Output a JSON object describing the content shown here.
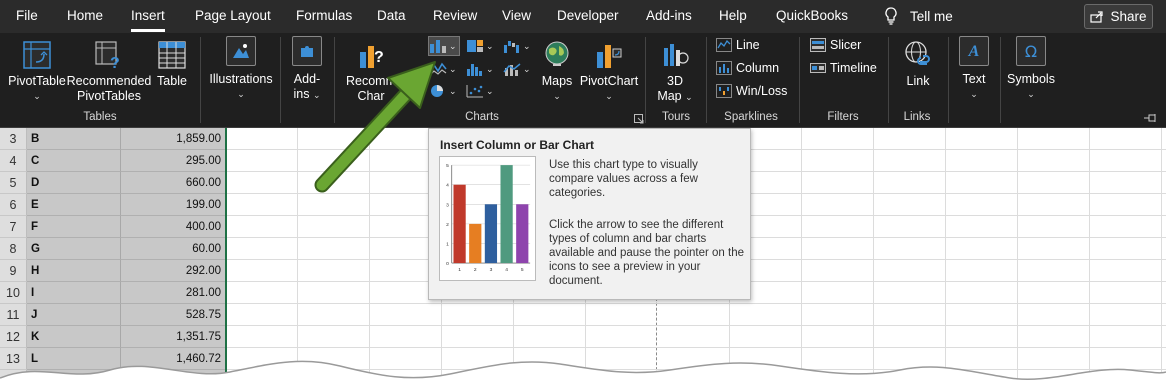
{
  "menu": {
    "tabs": [
      {
        "label": "File"
      },
      {
        "label": "Home"
      },
      {
        "label": "Insert"
      },
      {
        "label": "Page Layout"
      },
      {
        "label": "Formulas"
      },
      {
        "label": "Data"
      },
      {
        "label": "Review"
      },
      {
        "label": "View"
      },
      {
        "label": "Developer"
      },
      {
        "label": "Add-ins"
      },
      {
        "label": "Help"
      },
      {
        "label": "QuickBooks"
      }
    ],
    "active_tab": "Insert",
    "tell_me": "Tell me",
    "share": "Share"
  },
  "ribbon": {
    "groups": {
      "tables": "Tables",
      "charts": "Charts",
      "tours": "Tours",
      "sparklines": "Sparklines",
      "filters": "Filters",
      "links": "Links"
    },
    "pivot_table": "PivotTable",
    "recommended_line1": "Recommended",
    "recommended_line2": "PivotTables",
    "table": "Table",
    "illustrations": "Illustrations",
    "addins_line1": "Add-",
    "addins_line2": "ins",
    "rec_charts_line1": "Recomm",
    "rec_charts_line2": "Char",
    "maps": "Maps",
    "pivot_chart": "PivotChart",
    "map3d_line1": "3D",
    "map3d_line2": "Map",
    "spark_line": "Line",
    "spark_column": "Column",
    "spark_winloss": "Win/Loss",
    "slicer": "Slicer",
    "timeline": "Timeline",
    "link": "Link",
    "text": "Text",
    "symbols": "Symbols",
    "colors": {
      "accent_blue": "#3d8fd6",
      "accent_orange": "#f0a030",
      "arrow_green": "#6aa632"
    }
  },
  "sheet": {
    "rows": [
      {
        "num": "3",
        "label": "B",
        "value": "1,859.00"
      },
      {
        "num": "4",
        "label": "C",
        "value": "295.00"
      },
      {
        "num": "5",
        "label": "D",
        "value": "660.00"
      },
      {
        "num": "6",
        "label": "E",
        "value": "199.00"
      },
      {
        "num": "7",
        "label": "F",
        "value": "400.00"
      },
      {
        "num": "8",
        "label": "G",
        "value": "60.00"
      },
      {
        "num": "9",
        "label": "H",
        "value": "292.00"
      },
      {
        "num": "10",
        "label": "I",
        "value": "281.00"
      },
      {
        "num": "11",
        "label": "J",
        "value": "528.75"
      },
      {
        "num": "12",
        "label": "K",
        "value": "1,351.75"
      },
      {
        "num": "13",
        "label": "L",
        "value": "1,460.72"
      }
    ],
    "selection_color": "#c8c8c8"
  },
  "tooltip": {
    "title": "Insert Column or Bar Chart",
    "description": "Use this chart type to visually compare values across a few categories.",
    "hint": "Click the arrow to see the different types of column and bar charts available and pause the pointer on the icons to see a preview in your document.",
    "preview_chart": {
      "type": "bar",
      "categories": [
        "1",
        "2",
        "3",
        "4",
        "5"
      ],
      "values": [
        4,
        2,
        3,
        5,
        3
      ],
      "ylim": [
        0,
        5
      ],
      "colors": [
        "#c0392b",
        "#e67e22",
        "#2e5f9e",
        "#4f9a7f",
        "#8e44ad"
      ]
    }
  }
}
